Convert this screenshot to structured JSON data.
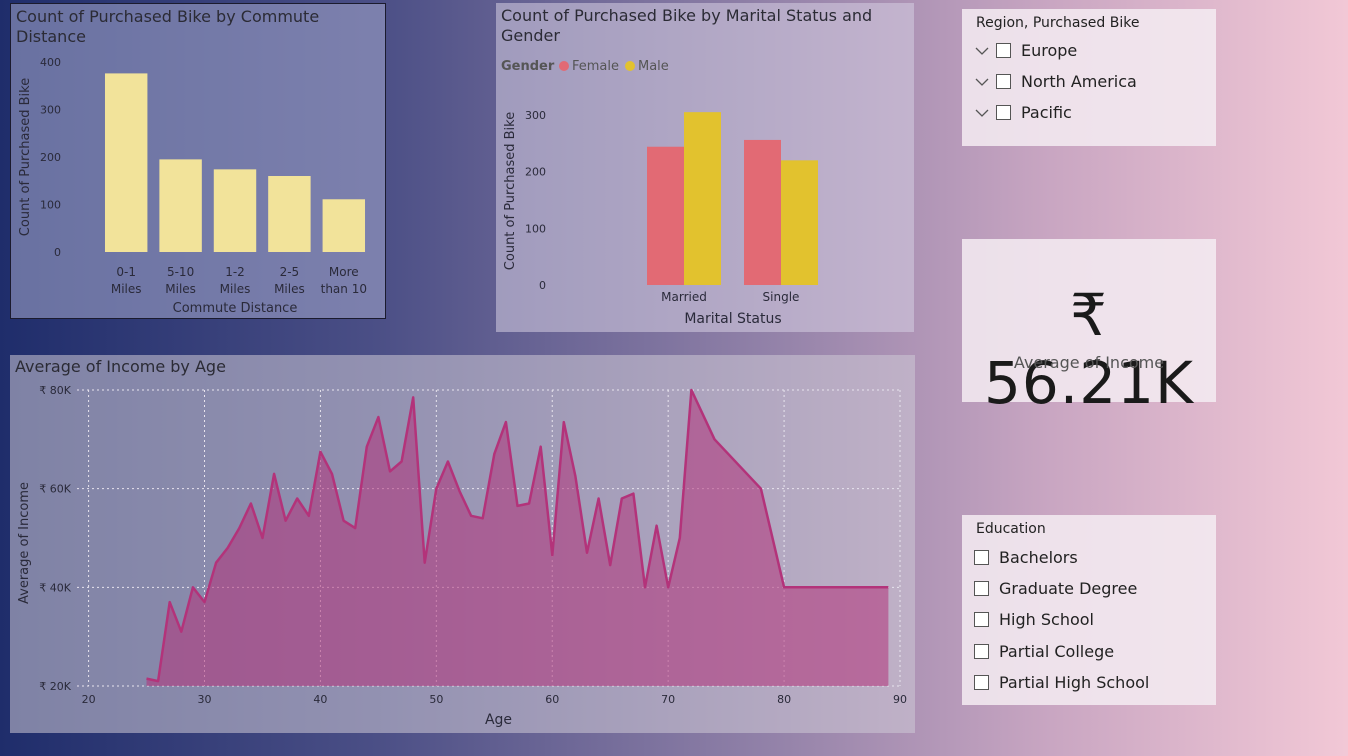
{
  "charts": {
    "commute": {
      "title_line1": "Count of Purchased Bike by Commute",
      "title_line2": "Distance"
    },
    "marital": {
      "title_line1": "Count of Purchased Bike by Marital Status and",
      "title_line2": "Gender",
      "legend_title": "Gender"
    },
    "income": {
      "title": "Average of Income by Age"
    }
  },
  "chart_data": [
    {
      "type": "bar",
      "title": "Count of Purchased Bike by Commute Distance",
      "xlabel": "Commute Distance",
      "ylabel": "Count of Purchased Bike",
      "categories": [
        "0-1 Miles",
        "5-10 Miles",
        "1-2 Miles",
        "2-5 Miles",
        "More than 10"
      ],
      "category_lines": [
        [
          "0-1",
          "Miles"
        ],
        [
          "5-10",
          "Miles"
        ],
        [
          "1-2",
          "Miles"
        ],
        [
          "2-5",
          "Miles"
        ],
        [
          "More",
          "than 10"
        ]
      ],
      "values": [
        376,
        195,
        174,
        160,
        111
      ],
      "ylim": [
        0,
        400
      ],
      "yticks": [
        0,
        100,
        200,
        300,
        400
      ],
      "color": "#f2e39a"
    },
    {
      "type": "bar",
      "title": "Count of Purchased Bike by Marital Status and Gender",
      "xlabel": "Marital Status",
      "ylabel": "Count of Purchased Bike",
      "categories": [
        "Married",
        "Single"
      ],
      "series": [
        {
          "name": "Female",
          "values": [
            244,
            256
          ],
          "color": "#e26a74"
        },
        {
          "name": "Male",
          "values": [
            305,
            220
          ],
          "color": "#e2c22e"
        }
      ],
      "ylim": [
        0,
        330
      ],
      "yticks": [
        0,
        100,
        200,
        300
      ],
      "legend": "top-left"
    },
    {
      "type": "area",
      "title": "Average of Income by Age",
      "xlabel": "Age",
      "ylabel": "Average of Income",
      "xlim": [
        19,
        90
      ],
      "ylim": [
        20000,
        80000
      ],
      "xticks": [
        20,
        30,
        40,
        50,
        60,
        70,
        80,
        90
      ],
      "yticks": [
        20000,
        40000,
        60000,
        80000
      ],
      "ytick_labels": [
        "₹ 20K",
        "₹ 40K",
        "₹ 60K",
        "₹ 80K"
      ],
      "color": "#b3337a",
      "x": [
        25,
        26,
        27,
        28,
        29,
        30,
        31,
        32,
        33,
        34,
        35,
        36,
        37,
        38,
        39,
        40,
        41,
        42,
        43,
        44,
        45,
        46,
        47,
        48,
        49,
        50,
        51,
        52,
        53,
        54,
        55,
        56,
        57,
        58,
        59,
        60,
        61,
        62,
        63,
        64,
        65,
        66,
        67,
        68,
        69,
        70,
        71,
        72,
        74,
        78,
        80,
        89
      ],
      "y": [
        21500,
        21000,
        37000,
        31000,
        40000,
        37000,
        45000,
        48000,
        52000,
        57000,
        50000,
        63000,
        53500,
        58000,
        54500,
        67500,
        63000,
        53500,
        52000,
        68500,
        74500,
        63500,
        65500,
        78500,
        45000,
        60000,
        65500,
        59500,
        54500,
        54000,
        67000,
        73500,
        56500,
        57000,
        68500,
        46500,
        73500,
        62500,
        47000,
        58000,
        44500,
        58000,
        59000,
        40000,
        52500,
        40000,
        50000,
        80000,
        70000,
        60000,
        40000,
        40000
      ]
    }
  ],
  "slicers": {
    "region": {
      "title": "Region, Purchased Bike",
      "items": [
        "Europe",
        "North America",
        "Pacific"
      ]
    },
    "education": {
      "title": "Education",
      "items": [
        "Bachelors",
        "Graduate Degree",
        "High School",
        "Partial College",
        "Partial High School"
      ]
    }
  },
  "kpi": {
    "value": "₹ 56.21K",
    "label": "Average of Income"
  }
}
